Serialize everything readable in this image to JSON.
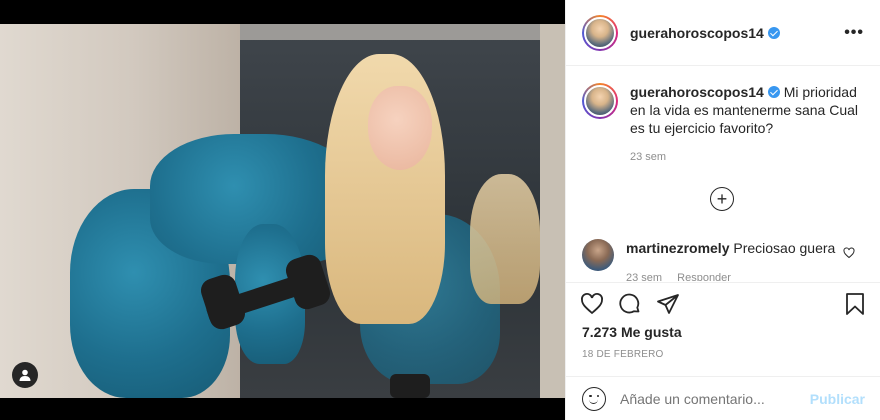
{
  "post": {
    "username": "guerahoroscopos14",
    "more_label": "•••",
    "icons": {
      "more": "more-horizontal-icon",
      "verified": "verified-badge-icon",
      "user_tag": "user-tag-icon"
    }
  },
  "caption": {
    "username": "guerahoroscopos14",
    "text": "Mi prioridad en la vida es mantenerme sana Cual es tu ejercicio favorito?",
    "time": "23 sem"
  },
  "load_more": {
    "icon": "plus-circle-icon",
    "label": "+"
  },
  "comments": [
    {
      "username": "martinezromely",
      "text": "Preciosao guera",
      "time": "23 sem",
      "reply_label": "Responder"
    }
  ],
  "actions": {
    "icons": [
      "heart-icon",
      "comment-icon",
      "share-icon",
      "bookmark-icon"
    ]
  },
  "likes": {
    "count": "7.273",
    "label": "Me gusta"
  },
  "date": "18 DE FEBRERO",
  "add_comment": {
    "placeholder": "Añade un comentario...",
    "publish_label": "Publicar"
  },
  "colors": {
    "link_blue": "#3897f0",
    "publish_disabled": "#b2dffc",
    "muted": "#8e8e8e",
    "text": "#262626"
  }
}
